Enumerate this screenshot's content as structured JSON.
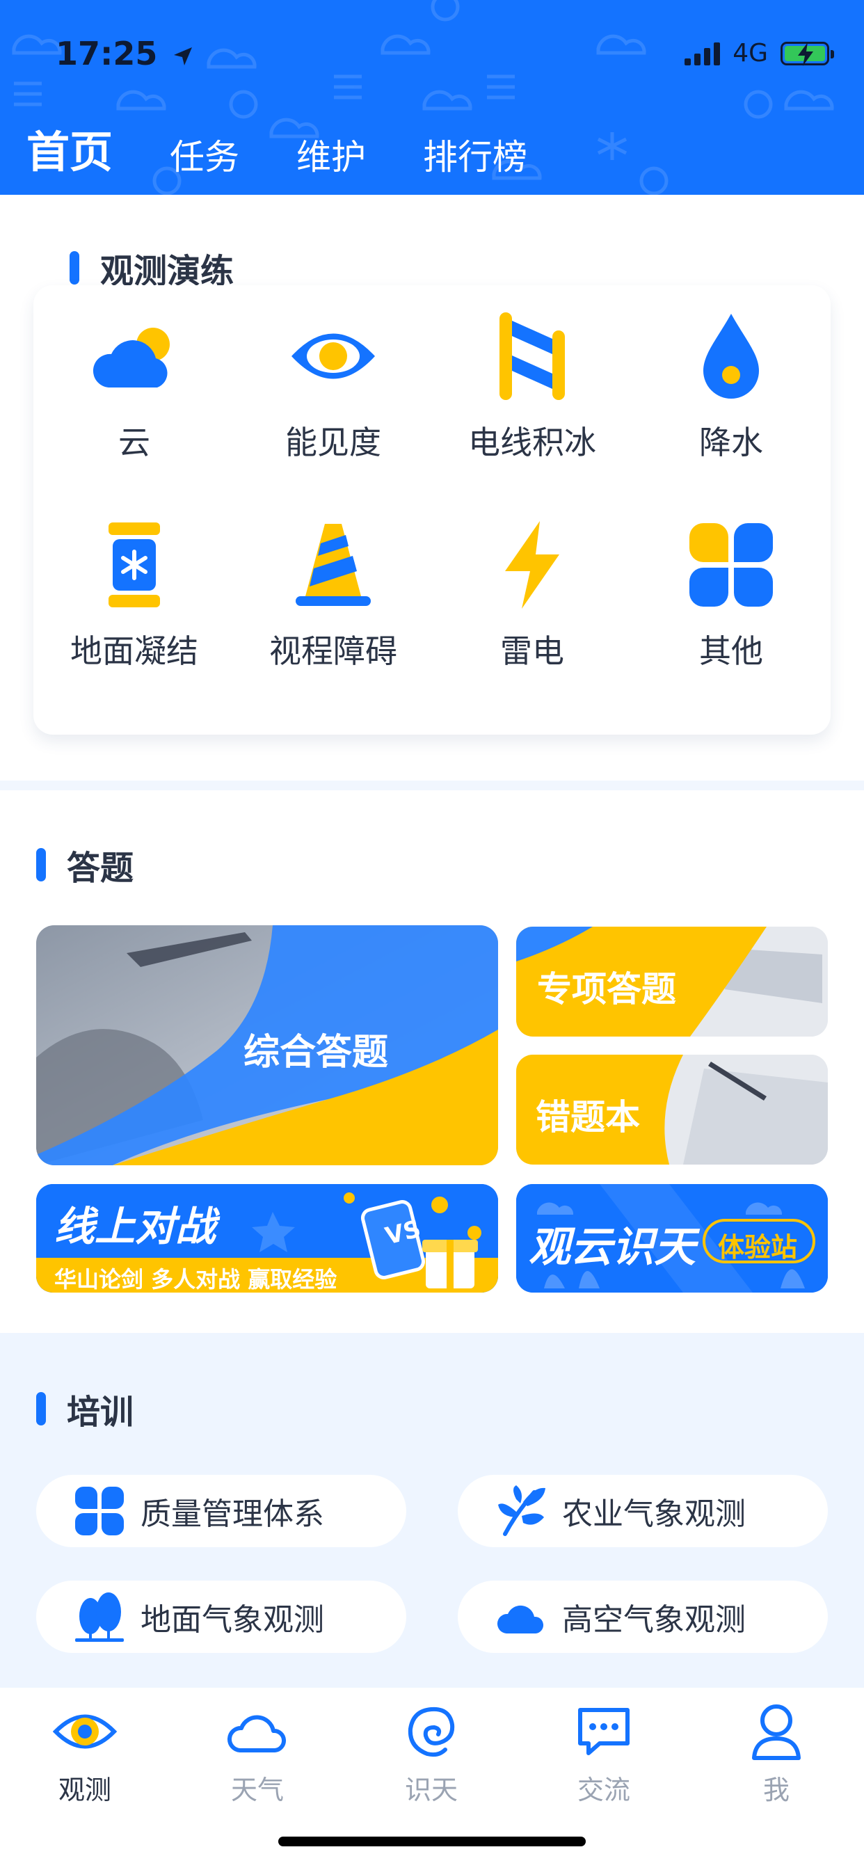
{
  "status_bar": {
    "time": "17:25",
    "network": "4G"
  },
  "tabs": [
    {
      "label": "首页",
      "active": true
    },
    {
      "label": "任务",
      "active": false
    },
    {
      "label": "维护",
      "active": false
    },
    {
      "label": "排行榜",
      "active": false
    }
  ],
  "observation": {
    "title": "观测演练",
    "items": [
      {
        "label": "云",
        "icon": "cloud-icon"
      },
      {
        "label": "能见度",
        "icon": "eye-icon"
      },
      {
        "label": "电线积冰",
        "icon": "wire-ice-icon"
      },
      {
        "label": "降水",
        "icon": "raindrop-icon"
      },
      {
        "label": "地面凝结",
        "icon": "ground-condensation-icon"
      },
      {
        "label": "视程障碍",
        "icon": "traffic-cone-icon"
      },
      {
        "label": "雷电",
        "icon": "lightning-icon"
      },
      {
        "label": "其他",
        "icon": "four-squares-icon"
      }
    ]
  },
  "quiz": {
    "title": "答题",
    "comprehensive": "综合答题",
    "special": "专项答题",
    "mistakes": "错题本",
    "battle": {
      "title": "线上对战",
      "subtitle": "华山论剑 多人对战 赢取经验",
      "badge": "VS"
    },
    "cloud": {
      "title": "观云识天",
      "badge": "体验站"
    }
  },
  "training": {
    "title": "培训",
    "items": [
      {
        "label": "质量管理体系",
        "icon": "clover-icon"
      },
      {
        "label": "农业气象观测",
        "icon": "leaf-icon"
      },
      {
        "label": "地面气象观测",
        "icon": "trees-icon"
      },
      {
        "label": "高空气象观测",
        "icon": "cloud-icon"
      }
    ]
  },
  "nav": [
    {
      "label": "观测",
      "icon": "eye-icon",
      "active": true
    },
    {
      "label": "天气",
      "icon": "cloud-icon",
      "active": false
    },
    {
      "label": "识天",
      "icon": "swirl-icon",
      "active": false
    },
    {
      "label": "交流",
      "icon": "chat-icon",
      "active": false
    },
    {
      "label": "我",
      "icon": "person-icon",
      "active": false
    }
  ],
  "colors": {
    "primary": "#1473ff",
    "accent": "#ffc400",
    "text": "#2b3446",
    "muted": "#9aa3b2"
  }
}
